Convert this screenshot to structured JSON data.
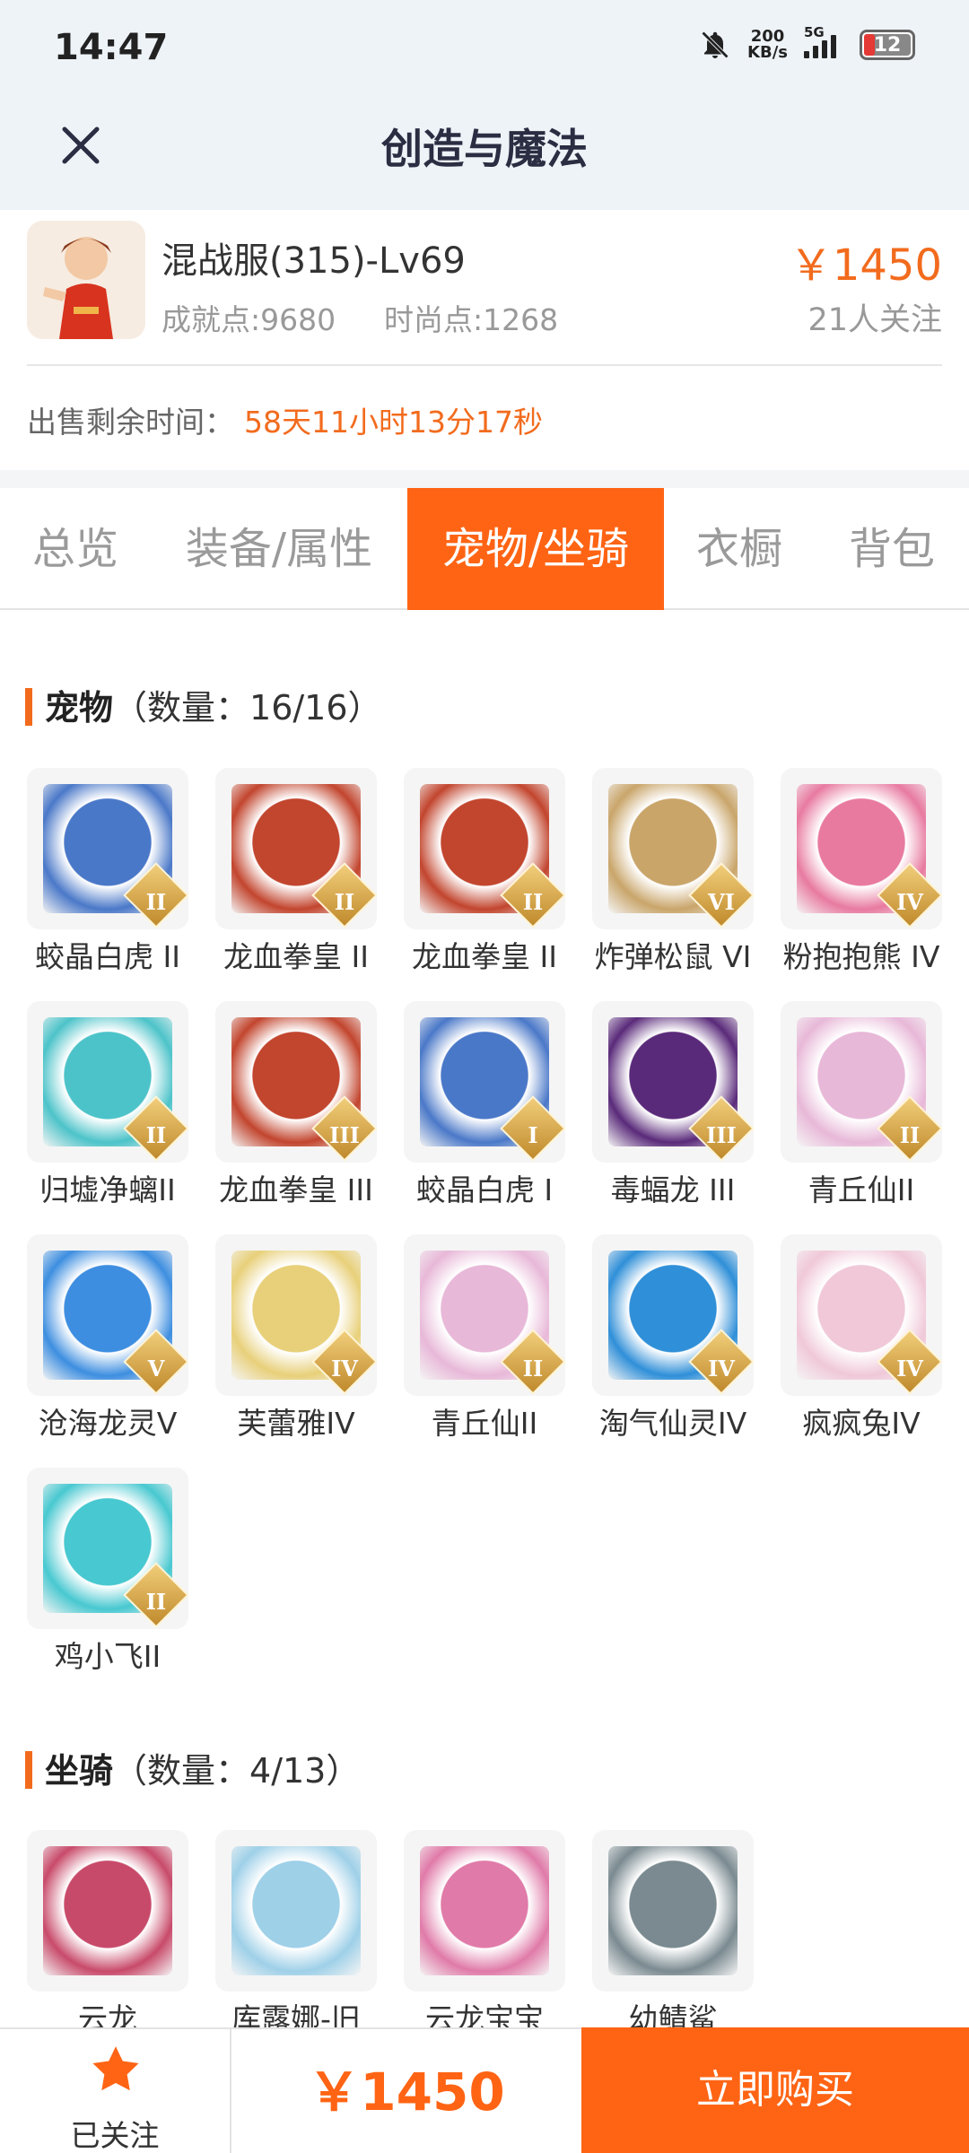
{
  "status_bar": {
    "time": "14:47",
    "net_speed_value": "200",
    "net_speed_unit": "KB/s",
    "network_type": "5G",
    "battery": "12"
  },
  "nav": {
    "title": "创造与魔法",
    "close_icon": "close-icon"
  },
  "role": {
    "name": "混战服(315)-Lv69",
    "achievement": "成就点:9680",
    "fashion": "时尚点:1268",
    "price": "￥1450",
    "followers": "21人关注",
    "sell_label": "出售剩余时间：",
    "sell_time": "58天11小时13分17秒"
  },
  "tabs": [
    {
      "label": "总览"
    },
    {
      "label": "装备/属性"
    },
    {
      "label": "宠物/坐骑",
      "active": true
    },
    {
      "label": "衣橱"
    },
    {
      "label": "背包"
    }
  ],
  "pets": {
    "title": "宠物",
    "count": "（数量：16/16）",
    "items": [
      {
        "name": "蛟晶白虎 II",
        "rank": "II",
        "color": "#4a78c8"
      },
      {
        "name": "龙血拳皇 II",
        "rank": "II",
        "color": "#c2452e"
      },
      {
        "name": "龙血拳皇 II",
        "rank": "II",
        "color": "#c2452e"
      },
      {
        "name": "炸弹松鼠 VI",
        "rank": "VI",
        "color": "#c9a56a"
      },
      {
        "name": "粉抱抱熊 IV",
        "rank": "IV",
        "color": "#e87aa0"
      },
      {
        "name": "归墟净螭II",
        "rank": "II",
        "color": "#4cc3c9"
      },
      {
        "name": "龙血拳皇 III",
        "rank": "III",
        "color": "#c2452e"
      },
      {
        "name": "蛟晶白虎 I",
        "rank": "I",
        "color": "#4a78c8"
      },
      {
        "name": "毒蝠龙 III",
        "rank": "III",
        "color": "#5a2a7a"
      },
      {
        "name": "青丘仙II",
        "rank": "II",
        "color": "#e8b8d8"
      },
      {
        "name": "沧海龙灵V",
        "rank": "V",
        "color": "#3d8ee0"
      },
      {
        "name": "芙蕾雅IV",
        "rank": "IV",
        "color": "#e8d07a"
      },
      {
        "name": "青丘仙II",
        "rank": "II",
        "color": "#e8b8d8"
      },
      {
        "name": "淘气仙灵IV",
        "rank": "IV",
        "color": "#2f8fd8"
      },
      {
        "name": "疯疯兔IV",
        "rank": "IV",
        "color": "#f0c8d8"
      },
      {
        "name": "鸡小飞II",
        "rank": "II",
        "color": "#48c8d0"
      }
    ]
  },
  "mounts": {
    "title": "坐骑",
    "count": "（数量：4/13）",
    "items": [
      {
        "name": "云龙",
        "color": "#c84a6a"
      },
      {
        "name": "库露娜-旧",
        "color": "#9ed0e8"
      },
      {
        "name": "云龙宝宝",
        "color": "#e07aa8"
      },
      {
        "name": "幼鲭鲨",
        "color": "#7a8a90"
      }
    ]
  },
  "bottom": {
    "follow_label": "已关注",
    "price": "￥1450",
    "buy_label": "立即购买"
  },
  "colors": {
    "accent": "#ff6414",
    "price": "#f26b1d"
  }
}
